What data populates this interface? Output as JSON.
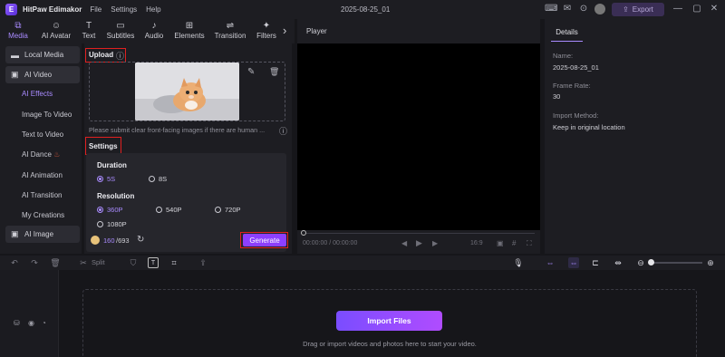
{
  "app": {
    "logo_letter": "E",
    "name": "HitPaw Edimakor",
    "menus": [
      "File",
      "Settings",
      "Help"
    ],
    "project_title": "2025-08-25_01",
    "export_label": "Export"
  },
  "toolbar": {
    "tools": [
      {
        "label": "Media",
        "icon": "media-icon",
        "glyph": "⧉"
      },
      {
        "label": "AI Avatar",
        "icon": "ai-avatar-icon",
        "glyph": "☺"
      },
      {
        "label": "Text",
        "icon": "text-icon",
        "glyph": "T"
      },
      {
        "label": "Subtitles",
        "icon": "subtitles-icon",
        "glyph": "▭"
      },
      {
        "label": "Audio",
        "icon": "audio-icon",
        "glyph": "♪"
      },
      {
        "label": "Elements",
        "icon": "elements-icon",
        "glyph": "⊞"
      },
      {
        "label": "Transition",
        "icon": "transition-icon",
        "glyph": "⇌"
      },
      {
        "label": "Filters",
        "icon": "filters-icon",
        "glyph": "✦"
      }
    ],
    "more_glyph": "›"
  },
  "sidebar": {
    "local_media": "Local Media",
    "ai_video": "AI Video",
    "subitems": [
      "AI Effects",
      "Image To Video",
      "Text to Video",
      "AI Dance",
      "AI Animation",
      "AI Transition",
      "My Creations"
    ],
    "ai_image": "AI Image"
  },
  "upload": {
    "title": "Upload",
    "info_glyph": "ⓘ",
    "hint": "Please submit clear front-facing images if there are human ...",
    "edit_glyph": "✎",
    "delete_glyph": "🗑"
  },
  "settings": {
    "title": "Settings",
    "duration_label": "Duration",
    "durations": [
      {
        "label": "5S",
        "selected": true
      },
      {
        "label": "8S",
        "selected": false
      }
    ],
    "resolution_label": "Resolution",
    "resolutions": [
      {
        "label": "360P",
        "selected": true
      },
      {
        "label": "540P",
        "selected": false
      },
      {
        "label": "720P",
        "selected": false
      },
      {
        "label": "1080P",
        "selected": false
      }
    ],
    "credits_used": "160",
    "credits_total": "/693",
    "generate_label": "Generate"
  },
  "player": {
    "title": "Player",
    "time": "00:00:00 / 00:00:00",
    "ratio": "16:9"
  },
  "details": {
    "tab": "Details",
    "name_key": "Name:",
    "name_val": "2025-08-25_01",
    "rate_key": "Frame Rate:",
    "rate_val": "30",
    "method_key": "Import Method:",
    "method_val": "Keep in original location"
  },
  "timeline": {
    "split_label": "Split",
    "import_label": "Import Files",
    "drop_hint": "Drag or import videos and photos here to start your video."
  },
  "colors": {
    "accent": "#a98bff",
    "highlight": "#e02020",
    "button": "#8d3fff"
  }
}
